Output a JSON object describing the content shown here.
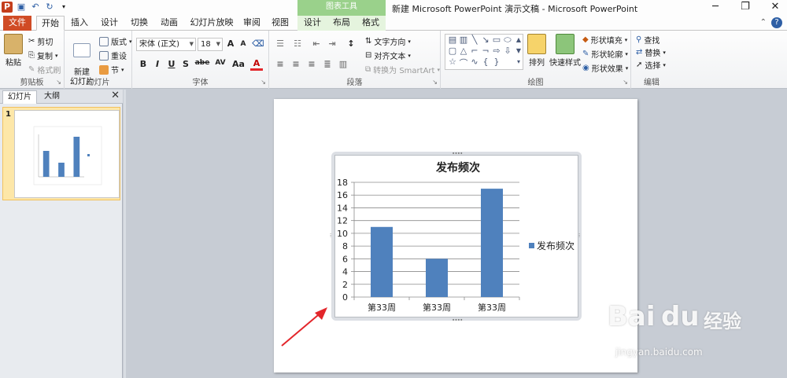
{
  "window": {
    "title": "新建 Microsoft PowerPoint 演示文稿 - Microsoft PowerPoint",
    "context_group": "图表工具",
    "app_icon": "P",
    "controls": [
      "─",
      "❐",
      "✕"
    ]
  },
  "tabs": [
    {
      "label": "文件"
    },
    {
      "label": "开始"
    },
    {
      "label": "插入"
    },
    {
      "label": "设计"
    },
    {
      "label": "切换"
    },
    {
      "label": "动画"
    },
    {
      "label": "幻灯片放映"
    },
    {
      "label": "审阅"
    },
    {
      "label": "视图"
    },
    {
      "label": "设计"
    },
    {
      "label": "布局"
    },
    {
      "label": "格式"
    }
  ],
  "ribbon": {
    "clipboard": {
      "label": "剪贴板",
      "paste": "粘贴",
      "cut": "剪切",
      "copy": "复制",
      "format_painter": "格式刷"
    },
    "slides": {
      "label": "幻灯片",
      "new_slide": "新建\n幻灯片",
      "layout": "版式",
      "reset": "重设",
      "section": "节"
    },
    "font": {
      "label": "字体",
      "font_name": "宋体 (正文)",
      "font_size": "18",
      "bold": "B",
      "italic": "I",
      "underline": "U",
      "strike": "S",
      "abc": "abe",
      "spacing": "AV",
      "case": "Aa",
      "color": "A",
      "grow": "A",
      "shrink": "A"
    },
    "paragraph": {
      "label": "段落",
      "text_direction": "文字方向",
      "align_text": "对齐文本",
      "smartart": "转换为 SmartArt"
    },
    "drawing": {
      "label": "绘图",
      "arrange": "排列",
      "quick_styles": "快速样式",
      "shape_fill": "形状填充",
      "shape_outline": "形状轮廓",
      "shape_effects": "形状效果"
    },
    "editing": {
      "label": "编辑",
      "find": "查找",
      "replace": "替换",
      "select": "选择"
    }
  },
  "pane": {
    "tab_slides": "幻灯片",
    "tab_outline": "大纲",
    "close": "✕",
    "slide_number": "1"
  },
  "colors": {
    "bar": "#4f81bd",
    "file_tab": "#d04b25",
    "context_header": "#9ad18b",
    "arrow": "#e3262b"
  },
  "chart_data": {
    "type": "bar",
    "title": "发布频次",
    "categories": [
      "第33周",
      "第33周",
      "第33周"
    ],
    "series": [
      {
        "name": "发布频次",
        "values": [
          11,
          6,
          17
        ]
      }
    ],
    "ylim": [
      0,
      18
    ],
    "yticks": [
      0,
      2,
      4,
      6,
      8,
      10,
      12,
      14,
      16,
      18
    ],
    "grid": true,
    "legend": "right"
  },
  "watermark": {
    "brand": "Bai",
    "paw": "du",
    "cn": "经验",
    "url": "jingyan.baidu.com"
  }
}
